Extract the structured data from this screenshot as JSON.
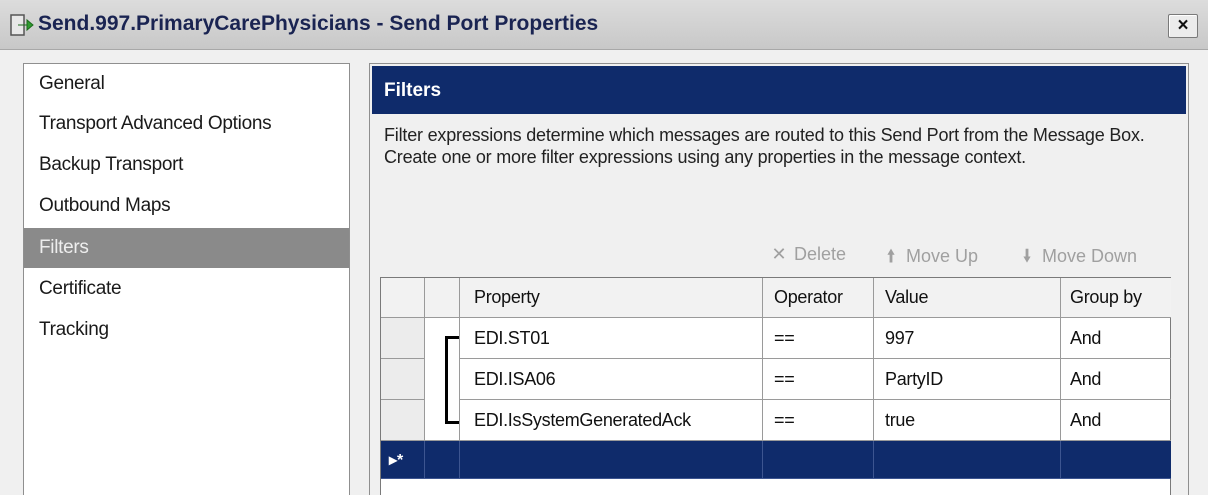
{
  "window": {
    "title": "Send.997.PrimaryCarePhysicians - Send Port Properties",
    "close_label": "×"
  },
  "sidebar": {
    "items": [
      {
        "label": "General"
      },
      {
        "label": "Transport Advanced Options"
      },
      {
        "label": "Backup Transport"
      },
      {
        "label": "Outbound Maps"
      },
      {
        "label": "Filters",
        "selected": true
      },
      {
        "label": "Certificate"
      },
      {
        "label": "Tracking"
      }
    ]
  },
  "panel": {
    "header": "Filters",
    "description": "Filter expressions determine which messages are routed to this Send Port from the Message Box. Create one or more filter expressions using any properties in the message context."
  },
  "toolbar": {
    "delete_label": "Delete",
    "move_up_label": "Move Up",
    "move_down_label": "Move Down",
    "delete_icon": "x-icon",
    "move_up_icon": "up-arrow-icon",
    "move_down_icon": "down-arrow-icon"
  },
  "grid": {
    "columns": [
      "Property",
      "Operator",
      "Value",
      "Group by"
    ],
    "rows": [
      {
        "property": "EDI.ST01",
        "operator": "==",
        "value": "997",
        "group_by": "And"
      },
      {
        "property": "EDI.ISA06",
        "operator": "==",
        "value": "PartyID",
        "group_by": "And"
      },
      {
        "property": "EDI.IsSystemGeneratedAck",
        "operator": "==",
        "value": "true",
        "group_by": "And"
      }
    ],
    "new_row_marker": "▸*"
  },
  "colors": {
    "header_blue": "#0f2b6b",
    "selected_nav": "#8a8a8a",
    "window_bg": "#f0f0f0"
  }
}
